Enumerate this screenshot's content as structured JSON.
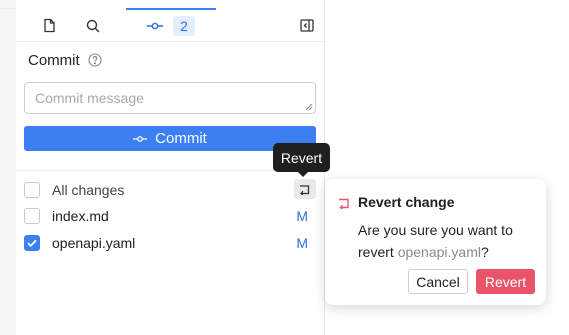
{
  "tabs": {
    "files_icon": "file-icon",
    "search_icon": "search-icon",
    "commit_icon": "git-commit-icon",
    "commit_count": "2",
    "collapse_icon": "collapse-panel-icon"
  },
  "commit_panel": {
    "title": "Commit",
    "message_placeholder": "Commit message",
    "commit_button_label": "Commit"
  },
  "changes": {
    "all_label": "All changes",
    "files": [
      {
        "name": "index.md",
        "status": "M",
        "checked": false
      },
      {
        "name": "openapi.yaml",
        "status": "M",
        "checked": true
      }
    ]
  },
  "tooltip": {
    "text": "Revert"
  },
  "popover": {
    "title": "Revert change",
    "body_prefix": "Are you sure you want to revert ",
    "file_name": "openapi.yaml",
    "body_suffix": "?",
    "cancel_label": "Cancel",
    "confirm_label": "Revert"
  },
  "colors": {
    "accent": "#3b7ff2",
    "danger": "#e9546b",
    "status_modified": "#2f6fdd"
  }
}
